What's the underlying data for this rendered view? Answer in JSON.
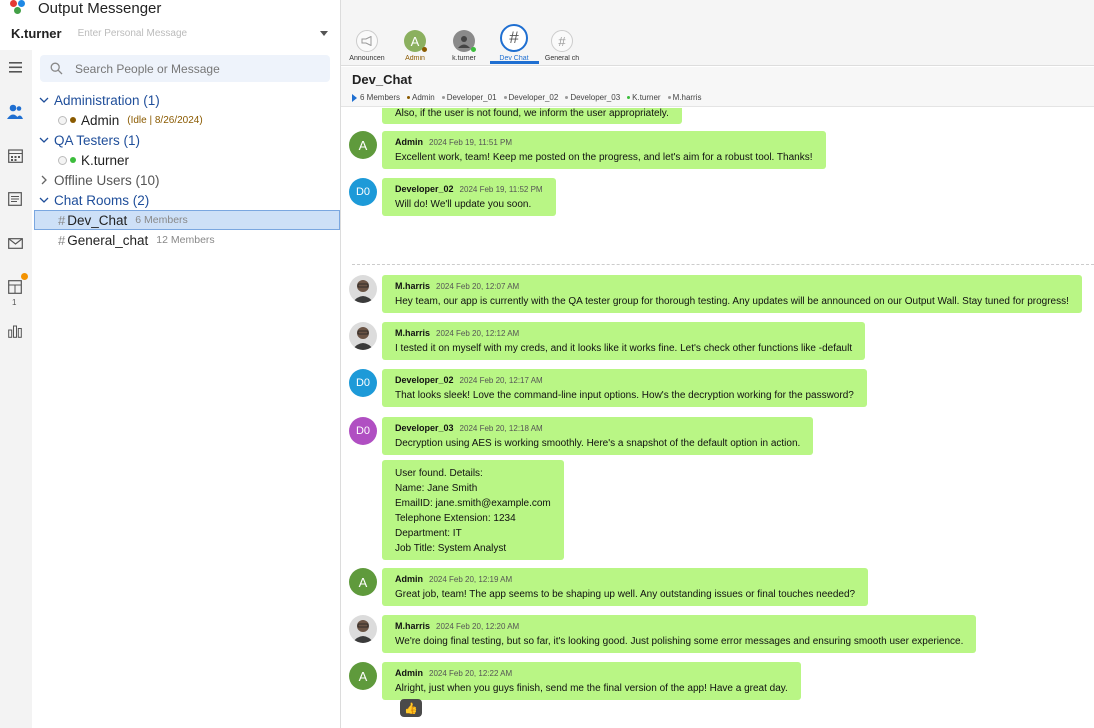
{
  "app": {
    "title": "Output Messenger"
  },
  "user": {
    "name": "K.turner",
    "personal_message_placeholder": "Enter Personal Message"
  },
  "search": {
    "placeholder": "Search People or Message"
  },
  "rail": {
    "notification_count": "1"
  },
  "tree": {
    "administration": {
      "label": "Administration (1)",
      "users": [
        {
          "name": "Admin",
          "status_text": "(Idle  | 8/26/2024)"
        }
      ]
    },
    "qa_testers": {
      "label": "QA Testers (1)",
      "users": [
        {
          "name": "K.turner"
        }
      ]
    },
    "offline": {
      "label": "Offline Users (10)"
    },
    "chat_rooms": {
      "label": "Chat Rooms (2)",
      "rooms": [
        {
          "name": "Dev_Chat",
          "members": "6 Members"
        },
        {
          "name": "General_chat",
          "members": "12 Members"
        }
      ]
    }
  },
  "tabs": [
    {
      "label": "Announcen",
      "icon": "megaphone-icon"
    },
    {
      "label": "Admin",
      "icon": "A"
    },
    {
      "label": "k.turner",
      "icon": "user-photo-icon"
    },
    {
      "label": "Dev Chat",
      "icon": "#"
    },
    {
      "label": "General ch",
      "icon": "#"
    }
  ],
  "chat": {
    "title": "Dev_Chat",
    "member_count": "6 Members",
    "members": [
      "Admin",
      "Developer_01",
      "Developer_02",
      "Developer_03",
      "K.turner",
      "M.harris"
    ]
  },
  "messages": [
    {
      "text": "Also, if the user is not found, we inform the user appropriately."
    },
    {
      "sender": "Admin",
      "time": "2024 Feb 19, 11:51 PM",
      "text": "Excellent work, team! Keep me posted on the progress, and let's aim for a robust tool. Thanks!",
      "avatar": "A"
    },
    {
      "sender": "Developer_02",
      "time": "2024 Feb 19, 11:52 PM",
      "text": "Will do! We'll update you soon.",
      "avatar": "D0"
    },
    {
      "sender": "M.harris",
      "time": "2024 Feb 20, 12:07 AM",
      "text": "Hey team, our app is currently with the QA tester group for thorough testing. Any updates will be announced on our Output Wall. Stay tuned for progress!"
    },
    {
      "sender": "M.harris",
      "time": "2024 Feb 20, 12:12 AM",
      "text": "I tested it on myself with my creds, and it looks like it works fine. Let's check other functions like -default"
    },
    {
      "sender": "Developer_02",
      "time": "2024 Feb 20, 12:17 AM",
      "text": "That looks sleek! Love the command-line input options. How's the decryption working for the password?",
      "avatar": "D0"
    },
    {
      "sender": "Developer_03",
      "time": "2024 Feb 20, 12:18 AM",
      "text": "Decryption using AES is working smoothly. Here's a snapshot of the default option in action.",
      "avatar": "D0"
    },
    {
      "lines": [
        "User found. Details:",
        "Name: Jane Smith",
        "EmailID: jane.smith@example.com",
        "Telephone Extension: 1234",
        "Department: IT",
        "Job Title: System Analyst"
      ]
    },
    {
      "sender": "Admin",
      "time": "2024 Feb 20, 12:19 AM",
      "text": "Great job, team! The app seems to be shaping up well. Any outstanding issues or final touches needed?",
      "avatar": "A"
    },
    {
      "sender": "M.harris",
      "time": "2024 Feb 20, 12:20 AM",
      "text": "We're doing final testing, but so far, it's looking good. Just polishing some error messages and ensuring smooth user experience."
    },
    {
      "sender": "Admin",
      "time": "2024 Feb 20, 12:22 AM",
      "text": "Alright, just when you guys finish, send me the final version of the app! Have a great day.",
      "avatar": "A"
    }
  ],
  "reaction": {
    "icon": "thumbs-up-icon",
    "glyph": "👍"
  },
  "colors": {
    "bubble": "#b9f685",
    "accent": "#1f6fd1",
    "admin_avatar": "#5f9a3c",
    "dev02_avatar": "#1d9ad8",
    "dev03_avatar": "#b04fc2",
    "group_text": "#1f4e9a"
  }
}
